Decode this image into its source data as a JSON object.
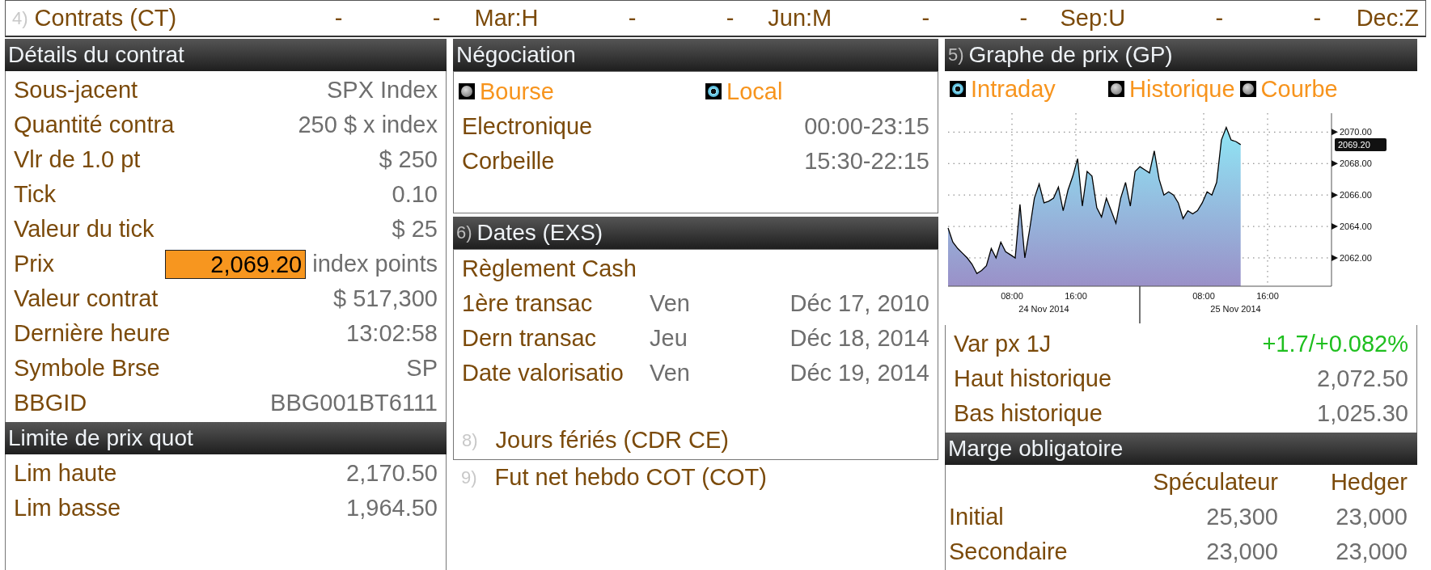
{
  "top_bar": {
    "number": "4)",
    "title": "Contrats (CT)",
    "months": [
      "-",
      "-",
      "Mar:H",
      "-",
      "-",
      "Jun:M",
      "-",
      "-",
      "Sep:U",
      "-",
      "-",
      "Dec:Z"
    ]
  },
  "contract_details": {
    "title": "Détails du contrat",
    "rows": [
      {
        "kind": "text",
        "label": "Sous-jacent",
        "value": "SPX Index"
      },
      {
        "kind": "text",
        "label": "Quantité contra",
        "value": "250 $ x index"
      },
      {
        "kind": "text",
        "label": "Vlr de 1.0 pt",
        "value": "$ 250"
      },
      {
        "kind": "text",
        "label": "Tick",
        "value": "0.10"
      },
      {
        "kind": "text",
        "label": "Valeur du tick",
        "value": "$ 25"
      },
      {
        "kind": "field",
        "label": "Prix",
        "value": "2,069.20",
        "unit": "index points"
      },
      {
        "kind": "text",
        "label": "Valeur contrat",
        "value": "$ 517,300"
      },
      {
        "kind": "text",
        "label": "Dernière heure",
        "value": "13:02:58"
      },
      {
        "kind": "text",
        "label": "Symbole Brse",
        "value": "SP"
      },
      {
        "kind": "text",
        "label": "BBGID",
        "value": "BBG001BT6111"
      }
    ]
  },
  "price_limits": {
    "title": "Limite de prix quot",
    "rows": [
      {
        "label": "Lim haute",
        "value": "2,170.50"
      },
      {
        "label": "Lim basse",
        "value": "1,964.50"
      }
    ]
  },
  "trading": {
    "title": "Négociation",
    "options": [
      {
        "label": "Bourse",
        "selected": false
      },
      {
        "label": "Local",
        "selected": true
      }
    ],
    "rows": [
      {
        "label": "Electronique",
        "value": "00:00-23:15"
      },
      {
        "label": "Corbeille",
        "value": "15:30-22:15"
      }
    ]
  },
  "dates": {
    "number": "6)",
    "title": "Dates (EXS)",
    "settlement": "Règlement Cash",
    "rows": [
      {
        "label": "1ère transac",
        "day": "Ven",
        "date": "Déc 17, 2010"
      },
      {
        "label": "Dern transac",
        "day": "Jeu",
        "date": "Déc 18, 2014"
      },
      {
        "label": "Date valorisatio",
        "day": "Ven",
        "date": "Déc 19, 2014"
      }
    ],
    "link": {
      "number": "8)",
      "label": "Jours fériés (CDR CE)"
    }
  },
  "cot_link": {
    "number": "9)",
    "label": "Fut net hebdo COT (COT)"
  },
  "price_graph": {
    "number": "5)",
    "title": "Graphe de prix (GP)",
    "options": [
      {
        "label": "Intraday",
        "selected": true
      },
      {
        "label": "Historique",
        "selected": false
      },
      {
        "label": "Courbe",
        "selected": false
      }
    ],
    "chart_data": {
      "type": "area",
      "grid": true,
      "values": [
        2063.9,
        2063.0,
        2062.6,
        2062.3,
        2062.0,
        2061.6,
        2061.0,
        2061.2,
        2061.5,
        2062.6,
        2062.0,
        2063.0,
        2062.4,
        2062.2,
        2062.0,
        2065.4,
        2062.0,
        2063.8,
        2065.8,
        2066.7,
        2065.5,
        2065.6,
        2065.8,
        2066.5,
        2065.0,
        2066.3,
        2067.2,
        2068.3,
        2065.3,
        2067.5,
        2067.2,
        2065.2,
        2064.6,
        2065.8,
        2065.0,
        2064.2,
        2065.8,
        2066.8,
        2065.3,
        2067.5,
        2067.8,
        2067.6,
        2067.4,
        2068.8,
        2067.0,
        2066.0,
        2066.2,
        2066.0,
        2065.5,
        2064.5,
        2065.0,
        2064.8,
        2065.0,
        2065.5,
        2066.2,
        2066.0,
        2066.8,
        2069.5,
        2070.3,
        2069.5,
        2069.4,
        2069.2
      ],
      "ylim": [
        2060.2,
        2071.2
      ],
      "yticks": [
        {
          "value": 2062,
          "label": "2062.00"
        },
        {
          "value": 2064,
          "label": "2064.00"
        },
        {
          "value": 2066,
          "label": "2066.00"
        },
        {
          "value": 2068,
          "label": "2068.00"
        },
        {
          "value": 2070,
          "label": "2070.00"
        }
      ]
    },
    "x_axis_days": [
      {
        "date": "24 Nov 2014",
        "times": [
          "08:00",
          "16:00"
        ]
      },
      {
        "date": "25 Nov 2014",
        "times": [
          "08:00",
          "16:00"
        ]
      }
    ],
    "last_price_tag": "2069.20",
    "stats": [
      {
        "kind": "change",
        "label": "Var px 1J",
        "value": "+1.7/+0.082%"
      },
      {
        "kind": "plain",
        "label": "Haut historique",
        "value": "2,072.50"
      },
      {
        "kind": "plain",
        "label": "Bas historique",
        "value": "1,025.30"
      }
    ]
  },
  "margin": {
    "title": "Marge obligatoire",
    "columns": [
      "Spéculateur",
      "Hedger"
    ],
    "rows": [
      {
        "label": "Initial",
        "values": [
          "25,300",
          "23,000"
        ]
      },
      {
        "label": "Secondaire",
        "values": [
          "23,000",
          "23,000"
        ]
      }
    ]
  }
}
